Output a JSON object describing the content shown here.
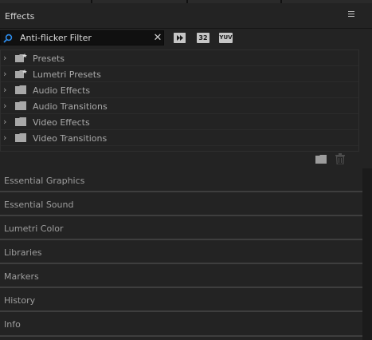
{
  "panel": {
    "title": "Effects",
    "menu_icon": "hamburger-menu-icon"
  },
  "search": {
    "value": "Anti-flicker Filter",
    "search_icon": "magnifier-icon",
    "clear_label": "✕"
  },
  "filters": {
    "accelerated_label": "",
    "accelerated_icon": "accelerated-effects-icon",
    "bit32_label": "32",
    "yuv_label": "YUV"
  },
  "tree": {
    "items": [
      {
        "label": "Presets",
        "icon": "preset-bin-icon"
      },
      {
        "label": "Lumetri Presets",
        "icon": "preset-bin-icon"
      },
      {
        "label": "Audio Effects",
        "icon": "folder-icon"
      },
      {
        "label": "Audio Transitions",
        "icon": "folder-icon"
      },
      {
        "label": "Video Effects",
        "icon": "folder-icon"
      },
      {
        "label": "Video Transitions",
        "icon": "folder-icon"
      }
    ]
  },
  "footer": {
    "new_bin_icon": "new-custom-bin-icon",
    "delete_icon": "trash-icon"
  },
  "collapsed_panels": [
    {
      "label": "Essential Graphics"
    },
    {
      "label": "Essential Sound"
    },
    {
      "label": "Lumetri Color"
    },
    {
      "label": "Libraries"
    },
    {
      "label": "Markers"
    },
    {
      "label": "History"
    },
    {
      "label": "Info"
    }
  ],
  "colors": {
    "panel_bg": "#232323",
    "search_bg": "#101010",
    "text": "#a8a8a8",
    "accent_blue": "#2d8ceb"
  }
}
